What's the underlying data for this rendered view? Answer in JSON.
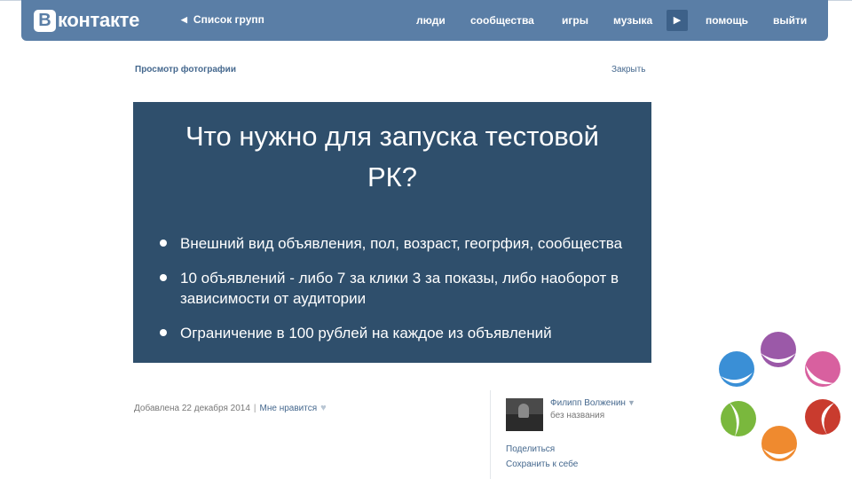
{
  "header": {
    "logo_letter": "В",
    "logo_text": "контакте",
    "back_label": "Список групп",
    "nav": [
      "люди",
      "сообщества",
      "игры",
      "музыка",
      "помощь",
      "выйти"
    ]
  },
  "viewer": {
    "title": "Просмотр фотографии",
    "close_label": "Закрыть"
  },
  "slide": {
    "title_line1": "Что нужно для запуска тестовой",
    "title_line2": "РК?",
    "bullets": [
      "Внешний вид объявления, пол, возраст, геогрфия, сообщества",
      "10 объявлений - либо 7 за клики 3 за показы, либо наоборот в зависимости от аудитории",
      "Ограничение в 100 рублей на каждое из объявлений"
    ]
  },
  "meta": {
    "added": "Добавлена 22 декабря 2014",
    "separator": "|",
    "like_label": "Мне нравится"
  },
  "sidebar": {
    "author": "Филипп Волженин",
    "album": "без названия",
    "share_label": "Поделиться",
    "save_label": "Сохранить к себе"
  },
  "colors": {
    "header_bg": "#5a7ea6",
    "slide_bg": "#2f4f6c",
    "link": "#45688e"
  }
}
